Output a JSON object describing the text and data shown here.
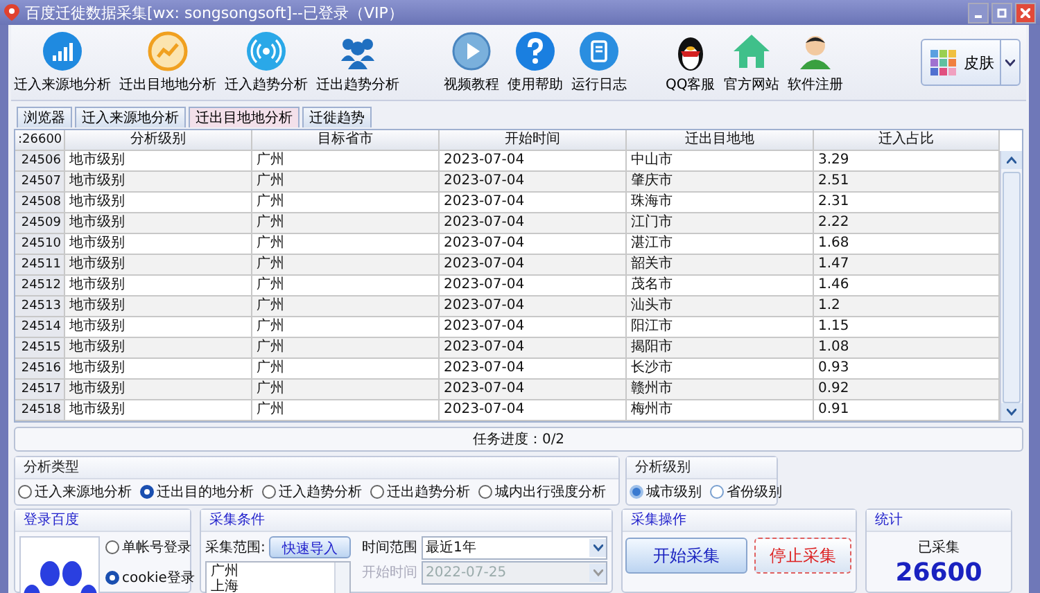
{
  "window": {
    "title": "百度迁徙数据采集[wx: songsongsoft]--已登录（VIP）"
  },
  "toolbar": {
    "groups": [
      [
        "迁入来源地分析",
        "迁出目地地分析",
        "迁入趋势分析",
        "迁出趋势分析"
      ],
      [
        "视频教程",
        "使用帮助",
        "运行日志"
      ],
      [
        "QQ客服",
        "官方网站",
        "软件注册"
      ]
    ],
    "skin": "皮肤"
  },
  "tabs": [
    {
      "label": "浏览器",
      "selected": false
    },
    {
      "label": "迁入来源地分析",
      "selected": false
    },
    {
      "label": "迁出目地地分析",
      "selected": true
    },
    {
      "label": "迁徙趋势",
      "selected": false
    }
  ],
  "table": {
    "corner": ":26600",
    "columns": [
      "分析级别",
      "目标省市",
      "开始时间",
      "迁出目地地",
      "迁入占比"
    ],
    "rows": [
      [
        "24506",
        "地市级别",
        "广州",
        "2023-07-04",
        "中山市",
        "3.29"
      ],
      [
        "24507",
        "地市级别",
        "广州",
        "2023-07-04",
        "肇庆市",
        "2.51"
      ],
      [
        "24508",
        "地市级别",
        "广州",
        "2023-07-04",
        "珠海市",
        "2.31"
      ],
      [
        "24509",
        "地市级别",
        "广州",
        "2023-07-04",
        "江门市",
        "2.22"
      ],
      [
        "24510",
        "地市级别",
        "广州",
        "2023-07-04",
        "湛江市",
        "1.68"
      ],
      [
        "24511",
        "地市级别",
        "广州",
        "2023-07-04",
        "韶关市",
        "1.47"
      ],
      [
        "24512",
        "地市级别",
        "广州",
        "2023-07-04",
        "茂名市",
        "1.46"
      ],
      [
        "24513",
        "地市级别",
        "广州",
        "2023-07-04",
        "汕头市",
        "1.2"
      ],
      [
        "24514",
        "地市级别",
        "广州",
        "2023-07-04",
        "阳江市",
        "1.15"
      ],
      [
        "24515",
        "地市级别",
        "广州",
        "2023-07-04",
        "揭阳市",
        "1.08"
      ],
      [
        "24516",
        "地市级别",
        "广州",
        "2023-07-04",
        "长沙市",
        "0.93"
      ],
      [
        "24517",
        "地市级别",
        "广州",
        "2023-07-04",
        "赣州市",
        "0.92"
      ],
      [
        "24518",
        "地市级别",
        "广州",
        "2023-07-04",
        "梅州市",
        "0.91"
      ]
    ]
  },
  "progress": {
    "text": "任务进度：0/2",
    "level": 0
  },
  "analysis_type": {
    "title": "分析类型",
    "options": [
      {
        "label": "迁入来源地分析",
        "selected": false
      },
      {
        "label": "迁出目的地分析",
        "selected": true
      },
      {
        "label": "迁入趋势分析",
        "selected": false
      },
      {
        "label": "迁出趋势分析",
        "selected": false
      },
      {
        "label": "城内出行强度分析",
        "selected": false
      }
    ]
  },
  "analysis_level": {
    "title": "分析级别",
    "options": [
      {
        "label": "城市级别",
        "selected": true
      },
      {
        "label": "省份级别",
        "selected": false
      }
    ]
  },
  "login": {
    "title": "登录百度",
    "options": [
      {
        "label": "单帐号登录",
        "selected": false
      },
      {
        "label": "cookie登录",
        "selected": true
      }
    ]
  },
  "conditions": {
    "title": "采集条件",
    "range_label": "采集范围:",
    "import_button": "快速导入",
    "range_lines": [
      "广州",
      "上海"
    ],
    "time_range_label": "时间范围",
    "time_range": "最近1年",
    "start_label": "开始时间",
    "start_value": "2022-07-25",
    "start_disabled": true
  },
  "operations": {
    "title": "采集操作",
    "start": "开始采集",
    "stop": "停止采集"
  },
  "stats": {
    "title": "统计",
    "label": "已采集",
    "value": "26600"
  }
}
